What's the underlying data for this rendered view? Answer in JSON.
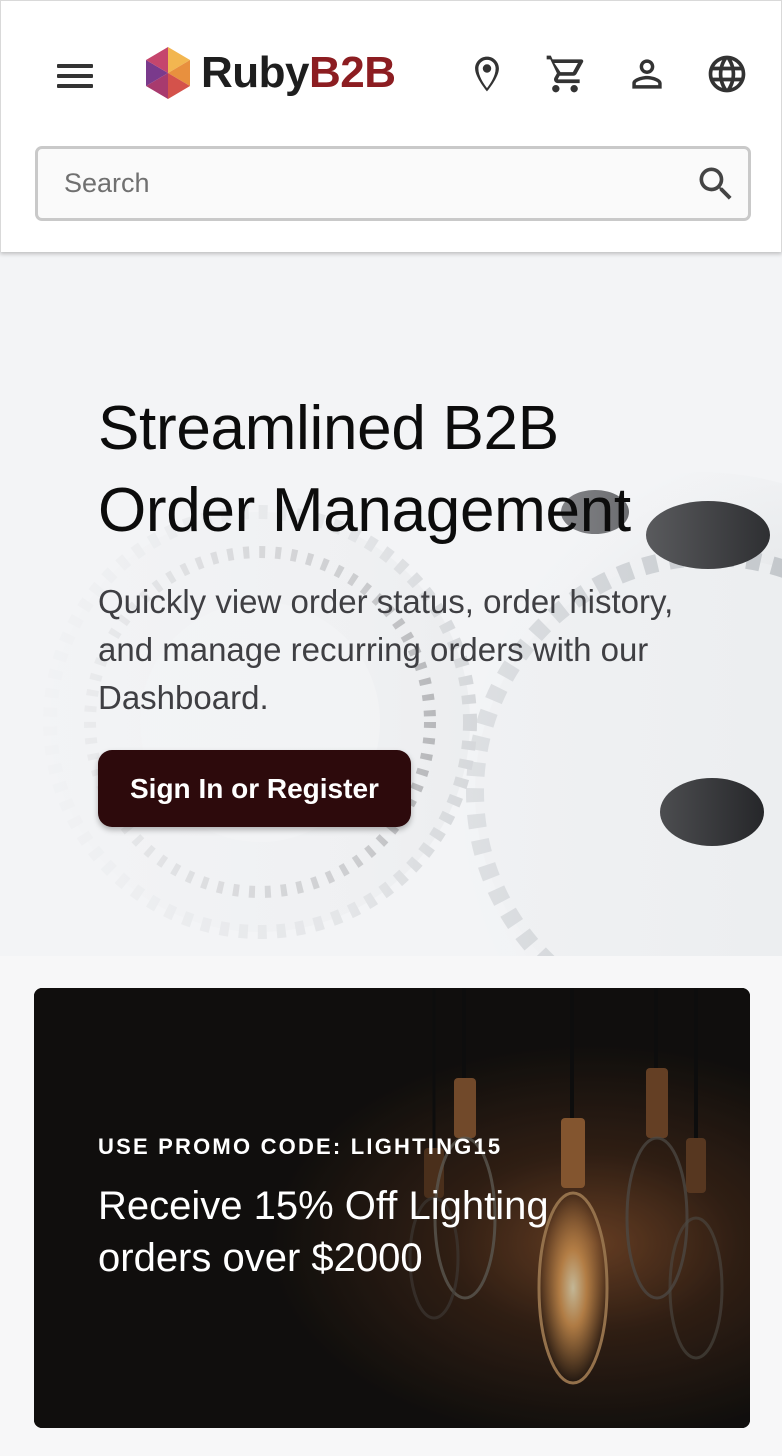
{
  "header": {
    "brand_part1": "Ruby",
    "brand_part2": "B2B",
    "icons": [
      "menu-icon",
      "location-pin-icon",
      "cart-icon",
      "user-icon",
      "globe-icon",
      "search-icon"
    ],
    "search": {
      "placeholder": "Search",
      "value": ""
    }
  },
  "hero": {
    "title": "Streamlined B2B Order Management",
    "subtitle": "Quickly view order status, order history, and manage recurring orders with our Dashboard.",
    "cta_label": "Sign In or Register"
  },
  "promo": {
    "code_label": "USE PROMO CODE: LIGHTING15",
    "text": "Receive 15% Off Lighting orders over $2000"
  },
  "colors": {
    "brand_dark": "#1e1e1e",
    "brand_accent": "#8c1d21",
    "cta_background": "#2d0a0c",
    "header_background": "#ffffff",
    "page_background": "#f7f7f8"
  }
}
